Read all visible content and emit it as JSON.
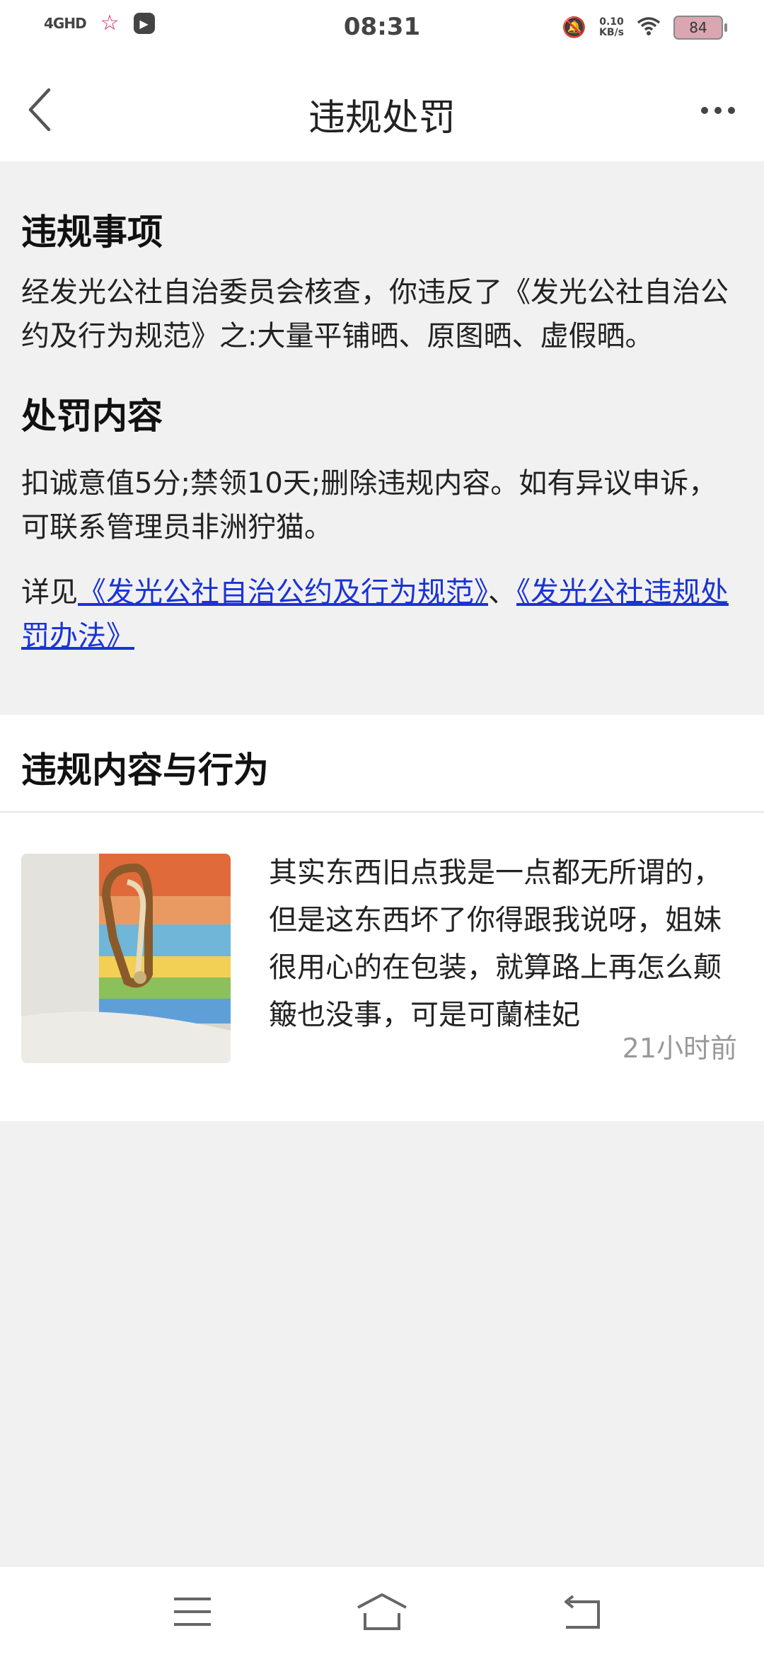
{
  "status_bar": {
    "network": "4GHD",
    "time": "08:31",
    "speed_value": "0.10",
    "speed_unit": "KB/s",
    "battery": "84"
  },
  "header": {
    "title": "违规处罚"
  },
  "violation": {
    "heading": "违规事项",
    "text": "经发光公社自治委员会核查，你违反了《发光公社自治公约及行为规范》之:大量平铺晒、原图晒、虚假晒。"
  },
  "penalty": {
    "heading": "处罚内容",
    "text": "扣诚意值5分;禁领10天;删除违规内容。如有异议申诉，可联系管理员非洲狞猫。",
    "see_prefix": "详见",
    "link1": "《发光公社自治公约及行为规范》",
    "separator": "、",
    "link2": "《发光公社违规处罚办法》"
  },
  "content_section": {
    "title": "违规内容与行为",
    "post_text": "其实东西旧点我是一点都无所谓的，但是这东西坏了你得跟我说呀，姐妹很用心的在包装，就算路上再怎么颠簸也没事，可是可蘭桂妃",
    "post_time": "21小时前"
  },
  "icons": {
    "back": "back-arrow-icon",
    "more": "more-icon",
    "menu": "menu-icon",
    "home": "home-icon",
    "return": "return-icon"
  }
}
